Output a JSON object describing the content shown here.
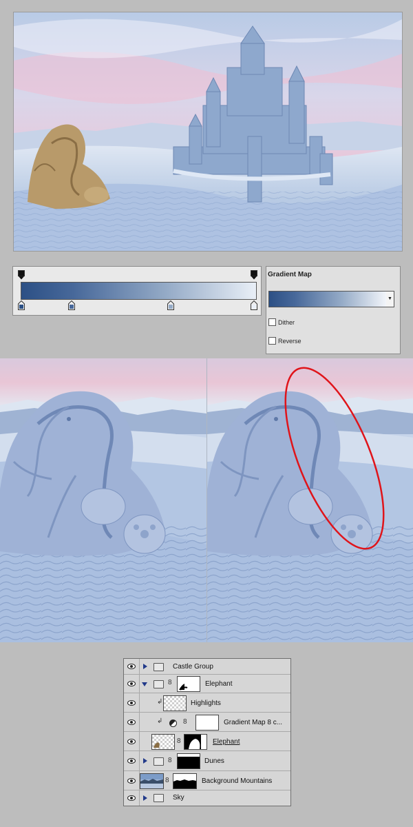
{
  "gradient_editor": {
    "colors": [
      "#2c5085",
      "#47689a",
      "#95abc7",
      "#e9eff7"
    ]
  },
  "gradient_map_panel": {
    "title": "Gradient Map",
    "dither_label": "Dither",
    "dither_checked": false,
    "reverse_label": "Reverse",
    "reverse_checked": false
  },
  "layers_panel": {
    "layers": [
      {
        "name": "Castle Group",
        "type": "group",
        "expanded": false
      },
      {
        "name": "Elephant",
        "type": "group",
        "expanded": true
      },
      {
        "name": "Highlights",
        "type": "layer",
        "clipped": true
      },
      {
        "name": "Gradient Map 8 c...",
        "type": "adjustment",
        "clipped": true
      },
      {
        "name": "Elephant",
        "type": "layer",
        "underlined": true
      },
      {
        "name": "Dunes",
        "type": "group",
        "expanded": false
      },
      {
        "name": "Background Mountains",
        "type": "layer"
      },
      {
        "name": "Sky",
        "type": "group",
        "expanded": false
      }
    ]
  },
  "highlight_color": "#e0141a"
}
